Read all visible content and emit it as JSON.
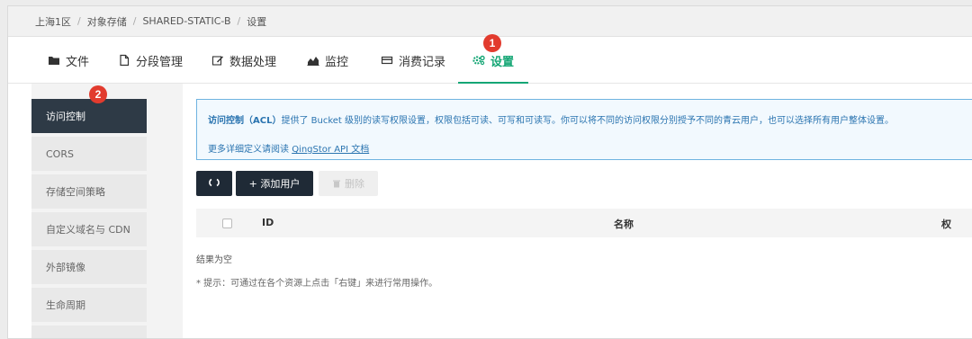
{
  "breadcrumb": [
    "上海1区",
    "对象存储",
    "SHARED-STATIC-B",
    "设置"
  ],
  "tabs": [
    {
      "label": "文件",
      "icon": "folder-icon"
    },
    {
      "label": "分段管理",
      "icon": "document-icon"
    },
    {
      "label": "数据处理",
      "icon": "edit-icon"
    },
    {
      "label": "监控",
      "icon": "chart-icon"
    },
    {
      "label": "消费记录",
      "icon": "billing-icon"
    },
    {
      "label": "设置",
      "icon": "gear-icon",
      "active": true
    }
  ],
  "badges": {
    "tab_settings": "1",
    "sidebar_access": "2"
  },
  "sidebar": [
    {
      "label": "访问控制",
      "active": true
    },
    {
      "label": "CORS"
    },
    {
      "label": "存储空间策略"
    },
    {
      "label": "自定义域名与 CDN"
    },
    {
      "label": "外部镜像"
    },
    {
      "label": "生命周期"
    }
  ],
  "info": {
    "title": "访问控制（ACL）",
    "text": "提供了 Bucket 级别的读写权限设置，权限包括可读、可写和可读写。你可以将不同的访问权限分别授予不同的青云用户，也可以选择所有用户整体设置。",
    "more_prefix": "更多详细定义请阅读",
    "more_link": "QingStor API 文档"
  },
  "toolbar": {
    "add_label": "+ 添加用户",
    "delete_label": "删除"
  },
  "table": {
    "columns": [
      "ID",
      "名称",
      "权"
    ]
  },
  "empty_text": "结果为空",
  "tip_text": "* 提示：可通过在各个资源上点击「右键」来进行常用操作。",
  "colors": {
    "accent": "#15a675",
    "dark": "#1f2a36",
    "badge": "#e23b2e",
    "info": "#2a74b0"
  }
}
